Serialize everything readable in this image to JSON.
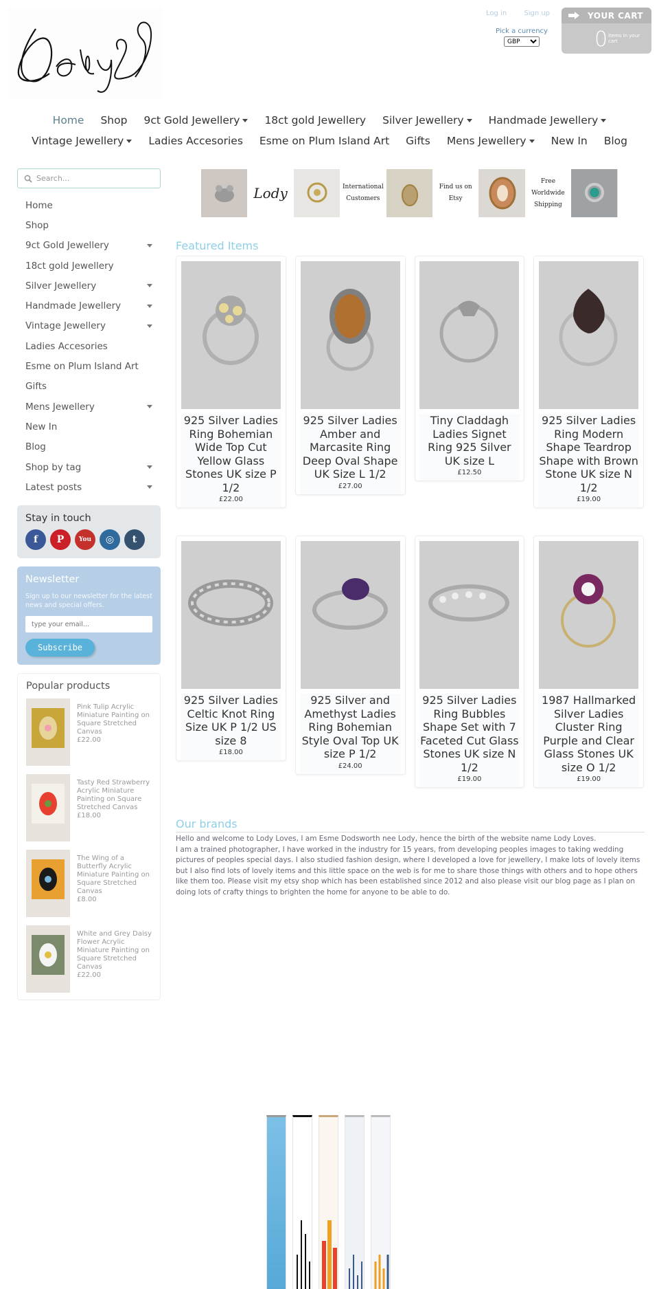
{
  "header": {
    "logo_text": "LodyS",
    "login": "Log in",
    "signup": "Sign up",
    "currency_label": "Pick a currency",
    "currency_value": "GBP",
    "cart_title": "YOUR CART",
    "cart_count": "0",
    "cart_items_text": "items in your cart"
  },
  "topnav": [
    {
      "label": "Home",
      "dropdown": false
    },
    {
      "label": "Shop",
      "dropdown": false
    },
    {
      "label": "9ct Gold Jewellery",
      "dropdown": true
    },
    {
      "label": "18ct gold Jewellery",
      "dropdown": false
    },
    {
      "label": "Silver Jewellery",
      "dropdown": true
    },
    {
      "label": "Handmade Jewellery",
      "dropdown": true
    },
    {
      "label": "Vintage Jewellery",
      "dropdown": true
    },
    {
      "label": "Ladies Accesories",
      "dropdown": false
    },
    {
      "label": "Esme on Plum Island Art",
      "dropdown": false
    },
    {
      "label": "Gifts",
      "dropdown": false
    },
    {
      "label": "Mens Jewellery",
      "dropdown": true
    },
    {
      "label": "New In",
      "dropdown": false
    },
    {
      "label": "Blog",
      "dropdown": false
    }
  ],
  "sidebar": {
    "search_placeholder": "Search...",
    "items": [
      {
        "label": "Home",
        "dropdown": false
      },
      {
        "label": "Shop",
        "dropdown": false
      },
      {
        "label": "9ct Gold Jewellery",
        "dropdown": true
      },
      {
        "label": "18ct gold Jewellery",
        "dropdown": false
      },
      {
        "label": "Silver Jewellery",
        "dropdown": true
      },
      {
        "label": "Handmade Jewellery",
        "dropdown": true
      },
      {
        "label": "Vintage Jewellery",
        "dropdown": true
      },
      {
        "label": "Ladies Accesories",
        "dropdown": false
      },
      {
        "label": "Esme on Plum Island Art",
        "dropdown": false
      },
      {
        "label": "Gifts",
        "dropdown": false
      },
      {
        "label": "Mens Jewellery",
        "dropdown": true
      },
      {
        "label": "New In",
        "dropdown": false
      },
      {
        "label": "Blog",
        "dropdown": false
      },
      {
        "label": "Shop by tag",
        "dropdown": true
      },
      {
        "label": "Latest posts",
        "dropdown": true
      }
    ],
    "stay_in_touch": "Stay in touch",
    "socials": [
      {
        "name": "facebook-icon",
        "glyph": "f",
        "color": "#3b5998"
      },
      {
        "name": "pinterest-icon",
        "glyph": "P",
        "color": "#cb2027"
      },
      {
        "name": "youtube-icon",
        "glyph": "You",
        "color": "#c4302b"
      },
      {
        "name": "instagram-icon",
        "glyph": "◎",
        "color": "#2e6a9c"
      },
      {
        "name": "tumblr-icon",
        "glyph": "t",
        "color": "#34526f"
      }
    ],
    "newsletter_title": "Newsletter",
    "newsletter_text": "Sign up to our newsletter for the latest news and special offers.",
    "newsletter_placeholder": "type your email...",
    "subscribe_label": "Subscribe",
    "popular_title": "Popular products",
    "popular": [
      {
        "title": "Pink Tulip Acrylic Miniature Painting on Square Stretched Canvas",
        "price": "£22.00"
      },
      {
        "title": "Tasty Red Strawberry Acrylic Miniature Painting on Square Stretched Canvas",
        "price": "£18.00"
      },
      {
        "title": "The Wing of a Butterfly Acrylic Miniature Painting on Square Stretched Canvas",
        "price": "£8.00"
      },
      {
        "title": "White and Grey Daisy Flower Acrylic Miniature Painting on Square Stretched Canvas",
        "price": "£22.00"
      }
    ]
  },
  "banner": {
    "logo_text": "Lody",
    "international": "International Customers",
    "etsy": "Find us on Etsy",
    "shipping": "Free Worldwide Shipping"
  },
  "featured_title": "Featured Items",
  "products_row1": [
    {
      "title": "925 Silver Ladies Ring Bohemian Wide Top Cut Yellow Glass Stones UK size P 1/2",
      "price": "£22.00"
    },
    {
      "title": "925 Silver Ladies Amber and Marcasite Ring Deep Oval Shape UK Size L 1/2",
      "price": "£27.00"
    },
    {
      "title": "Tiny Claddagh Ladies Signet Ring 925 Silver UK size L",
      "price": "£12.50"
    },
    {
      "title": "925 Silver Ladies Ring Modern Shape Teardrop Shape with Brown Stone UK size N 1/2",
      "price": "£19.00"
    }
  ],
  "products_row2": [
    {
      "title": "925 Silver Ladies Celtic Knot Ring Size UK P 1/2 US size 8",
      "price": "£18.00"
    },
    {
      "title": "925 Silver and Amethyst Ladies Ring Bohemian Style Oval Top UK size P 1/2",
      "price": "£24.00"
    },
    {
      "title": "925 Silver Ladies Ring Bubbles Shape Set with 7 Faceted Cut Glass Stones UK size N 1/2",
      "price": "£19.00"
    },
    {
      "title": "1987 Hallmarked Silver Ladies Cluster Ring Purple and Clear Glass Stones UK size O 1/2",
      "price": "£19.00"
    }
  ],
  "brands_title": "Our brands",
  "brands_paragraphs": [
    "Hello and welcome to Lody Loves, I am Esme Dodsworth nee Lody, hence the birth of the website name Lody Loves.",
    "I am a trained photographer, I have worked in the industry for 15 years, from developing peoples images to taking wedding pictures of peoples special days.  I also studied fashion design, where I developed a love for jewellery, I make lots of lovely items but I also find lots of lovely items and this little space on the web is for me to share those things with others and to hope others like them too. Please visit my etsy shop which has been established since 2012 and also please visit our blog page as I plan on doing lots of crafty things to brighten the home for anyone to be able to do."
  ],
  "colors": {
    "accent": "#8ed0e8",
    "subscribe": "#58b2da",
    "newsletter_bg": "#b6cfe6",
    "cart_bg": "#c8c8c8"
  }
}
